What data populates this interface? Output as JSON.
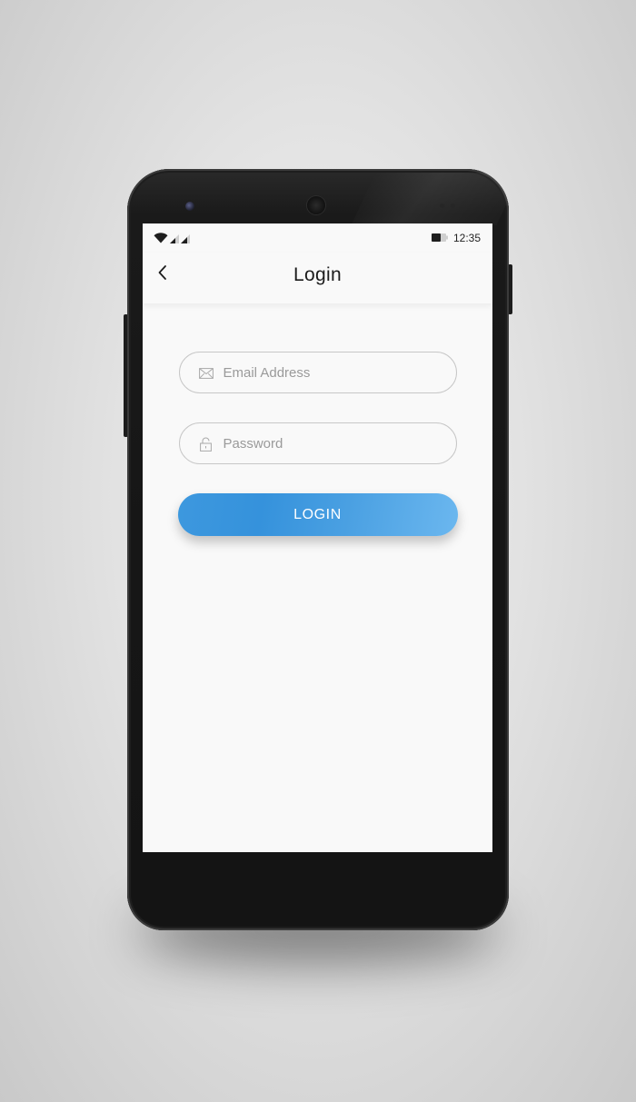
{
  "status_bar": {
    "time": "12:35",
    "icons": [
      "wifi-icon",
      "cell-signal-icon",
      "cell-signal-icon",
      "battery-icon"
    ]
  },
  "app_bar": {
    "title": "Login",
    "back_icon": "chevron-left-icon"
  },
  "form": {
    "email": {
      "placeholder": "Email Address",
      "value": "",
      "icon": "envelope-icon"
    },
    "password": {
      "placeholder": "Password",
      "value": "",
      "icon": "lock-icon"
    },
    "login_button": {
      "label": "LOGIN"
    }
  },
  "colors": {
    "accent_start": "#3592dc",
    "accent_end": "#6bb7ef",
    "screen_bg": "#f9f9f9",
    "field_border": "#c7c7c7",
    "placeholder": "#9a9a9a"
  }
}
